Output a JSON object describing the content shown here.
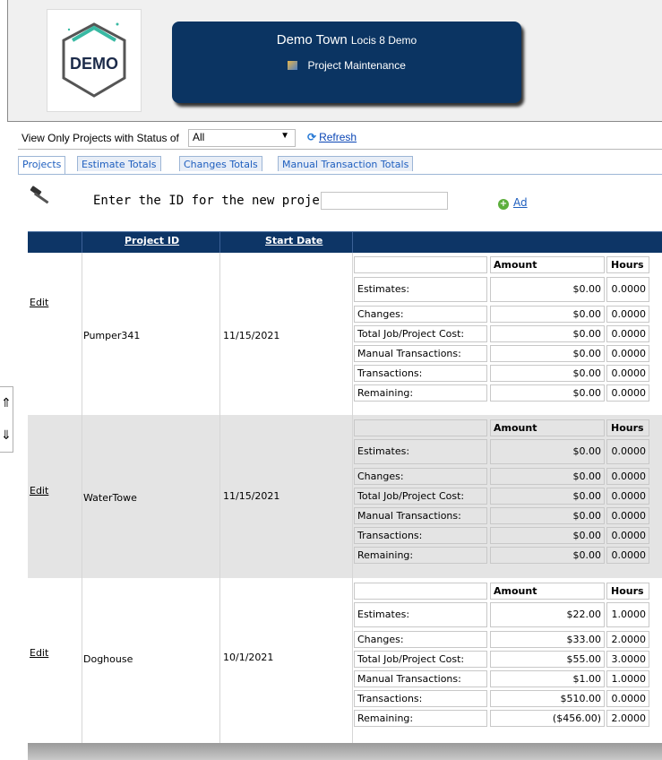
{
  "header": {
    "logo_text": "DEMO",
    "town_name": "Demo Town",
    "app_name": "Locis 8 Demo",
    "page_title": "Project Maintenance"
  },
  "filter": {
    "label": "View Only Projects with Status of",
    "status_value": "All",
    "refresh_label": "Refresh"
  },
  "tabs": [
    {
      "label": "Projects",
      "active": true
    },
    {
      "label": "Estimate Totals",
      "active": false
    },
    {
      "label": "Changes Totals",
      "active": false
    },
    {
      "label": "Manual Transaction Totals",
      "active": false
    }
  ],
  "new_project": {
    "label": "Enter the ID for the new project:",
    "add_label": "Ad"
  },
  "grid": {
    "columns": {
      "project_id": "Project ID",
      "start_date": "Start Date"
    },
    "summary_headers": {
      "amount": "Amount",
      "hours": "Hours"
    },
    "edit_label": "Edit",
    "rows": [
      {
        "project_id": "Pumper341",
        "start_date": "11/15/2021",
        "summary": [
          {
            "label": "Estimates:",
            "amount": "$0.00",
            "hours": "0.0000"
          },
          {
            "label": "Changes:",
            "amount": "$0.00",
            "hours": "0.0000"
          },
          {
            "label": "Total Job/Project Cost:",
            "amount": "$0.00",
            "hours": "0.0000"
          },
          {
            "label": "Manual Transactions:",
            "amount": "$0.00",
            "hours": "0.0000"
          },
          {
            "label": "Transactions:",
            "amount": "$0.00",
            "hours": "0.0000"
          },
          {
            "label": "Remaining:",
            "amount": "$0.00",
            "hours": "0.0000"
          }
        ]
      },
      {
        "project_id": "WaterTowe",
        "start_date": "11/15/2021",
        "summary": [
          {
            "label": "Estimates:",
            "amount": "$0.00",
            "hours": "0.0000"
          },
          {
            "label": "Changes:",
            "amount": "$0.00",
            "hours": "0.0000"
          },
          {
            "label": "Total Job/Project Cost:",
            "amount": "$0.00",
            "hours": "0.0000"
          },
          {
            "label": "Manual Transactions:",
            "amount": "$0.00",
            "hours": "0.0000"
          },
          {
            "label": "Transactions:",
            "amount": "$0.00",
            "hours": "0.0000"
          },
          {
            "label": "Remaining:",
            "amount": "$0.00",
            "hours": "0.0000"
          }
        ]
      },
      {
        "project_id": "Doghouse",
        "start_date": "10/1/2021",
        "summary": [
          {
            "label": "Estimates:",
            "amount": "$22.00",
            "hours": "1.0000"
          },
          {
            "label": "Changes:",
            "amount": "$33.00",
            "hours": "2.0000"
          },
          {
            "label": "Total Job/Project Cost:",
            "amount": "$55.00",
            "hours": "3.0000"
          },
          {
            "label": "Manual Transactions:",
            "amount": "$1.00",
            "hours": "1.0000"
          },
          {
            "label": "Transactions:",
            "amount": "$510.00",
            "hours": "0.0000"
          },
          {
            "label": "Remaining:",
            "amount": "($456.00)",
            "hours": "2.0000"
          }
        ]
      }
    ]
  },
  "colors": {
    "banner_bg": "#0b3462",
    "grid_header_bg": "#0d3566",
    "alt_row_bg": "#e4e4e4",
    "link_blue": "#1f5fbf"
  }
}
